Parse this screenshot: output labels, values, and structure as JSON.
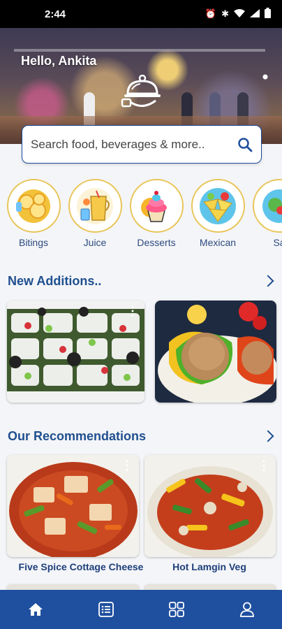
{
  "status_bar": {
    "time": "2:44"
  },
  "header": {
    "greeting": "Hello, Ankita"
  },
  "search": {
    "placeholder": "Search food, beverages & more.."
  },
  "categories": [
    {
      "label": "Bitings",
      "icon": "lemon-slices-icon"
    },
    {
      "label": "Juice",
      "icon": "juice-pitcher-icon"
    },
    {
      "label": "Desserts",
      "icon": "cupcake-icon"
    },
    {
      "label": "Mexican",
      "icon": "nachos-icon"
    },
    {
      "label": "Sa",
      "icon": "salad-icon"
    }
  ],
  "new_additions": {
    "title": "New Additions..",
    "items": [
      {
        "image": "veg-pizza-squares-photo"
      },
      {
        "image": "stuffed-peppers-photo"
      }
    ]
  },
  "recommendations": {
    "title": "Our Recommendations",
    "items": [
      {
        "name": "Five Spice Cottage Cheese",
        "image": "paneer-curry-photo"
      },
      {
        "name": "Hot Lamgin Veg",
        "image": "veg-stirfry-photo"
      }
    ]
  },
  "bottom_nav": [
    {
      "name": "home",
      "icon": "home-icon",
      "active": true
    },
    {
      "name": "orders",
      "icon": "list-icon",
      "active": false
    },
    {
      "name": "categories",
      "icon": "grid-icon",
      "active": false
    },
    {
      "name": "profile",
      "icon": "user-icon",
      "active": false
    }
  ],
  "colors": {
    "primary": "#1f4f9f",
    "accent": "#e8c558",
    "background": "#f4f5f8"
  }
}
